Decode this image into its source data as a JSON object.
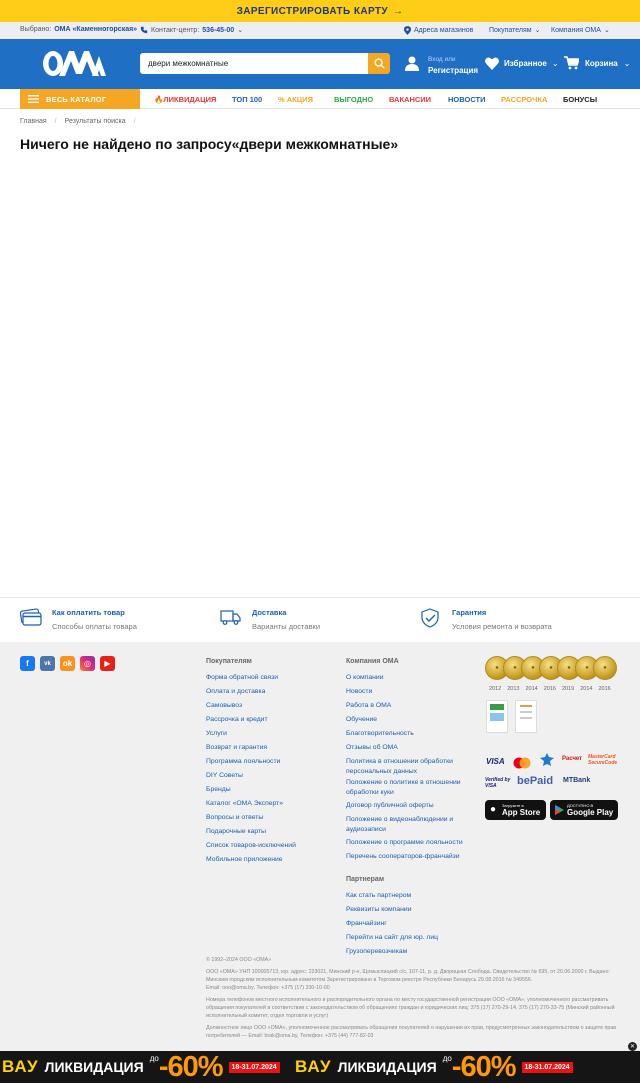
{
  "top_banner": {
    "label": "ЗАРЕГИСТРИРОВАТЬ КАРТУ",
    "arrow": "→"
  },
  "infobar": {
    "selected_prefix": "Выбрано:",
    "selected_store": "ОМА «Каменногорская»",
    "contact_label": "Контакт-центр:",
    "contact_number": "536-45-00",
    "stores_link": "Адреса магазинов",
    "buyers_menu": "Покупателям",
    "company_menu": "Компания ОМА"
  },
  "header": {
    "logo_text": "ОМА",
    "search_value": "двери межкомнатные",
    "login_hint": "Вход или",
    "register": "Регистрация",
    "favorites": "Избранное",
    "cart": "Корзина"
  },
  "nav": {
    "catalog": "ВЕСЬ КАТАЛОГ",
    "items": [
      {
        "label": "ЛИКВИДАЦИЯ",
        "color": "#e53935"
      },
      {
        "label": "ТОП 100",
        "color": "#1b5fb0"
      },
      {
        "label": "АКЦИЯ",
        "color": "#f5a623"
      },
      {
        "label": "ВЫГОДНО",
        "color": "#27a844"
      },
      {
        "label": "ВАКАНСИИ",
        "color": "#e53935"
      },
      {
        "label": "НОВОСТИ",
        "color": "#1b5fb0"
      },
      {
        "label": "РАССРОЧКА",
        "color": "#f5a623"
      },
      {
        "label": "БОНУСЫ",
        "color": "#222222"
      }
    ]
  },
  "breadcrumb": {
    "home": "Главная",
    "current": "Результаты поиска"
  },
  "page_title": "Ничего не найдено по запросу«двери межкомнатные»",
  "features": [
    {
      "title": "Как оплатить товар",
      "subtitle": "Способы оплаты товара"
    },
    {
      "title": "Доставка",
      "subtitle": "Варианты доставки"
    },
    {
      "title": "Гарантия",
      "subtitle": "Условия ремонта и возврата"
    }
  ],
  "footer": {
    "buyers_heading": "Покупателям",
    "buyers_links": [
      "Форма обратной связи",
      "Оплата и доставка",
      "Самовывоз",
      "Рассрочка и кредит",
      "Услуги",
      "Возврат и гарантия",
      "Программа лояльности",
      "DIY Советы",
      "Бренды",
      "Каталог «ОМА Эксперт»",
      "Вопросы и ответы",
      "Подарочные карты",
      "Список товаров-исключений",
      "Мобильное приложение"
    ],
    "company_heading": "Компания ОМА",
    "company_links": [
      "О компании",
      "Новости",
      "Работа в ОМА",
      "Обучение",
      "Благотворительность",
      "Отзывы об ОМА",
      "Политика в отношении обработки персональных данных",
      "Положение о политике в отношении обработки куки",
      "Договор публичной оферты",
      "Положение о видеонаблюдении и аудиозаписи",
      "Положение о программе лояльности",
      "Перечень сооператоров-франчайзи"
    ],
    "partners_heading": "Партнерам",
    "partners_links": [
      "Как стать партнером",
      "Реквизиты компании",
      "Франчайзинг",
      "Перейти на сайт для юр. лиц",
      "Грузоперевозчикам"
    ],
    "medal_years": [
      "2012",
      "2013",
      "2014",
      "2016",
      "2019",
      "2014",
      "2016"
    ],
    "payments": [
      "VISA",
      "MasterCard",
      "Белкарт",
      "Расчет",
      "MasterCard SecureCode",
      "Verified by VISA",
      "bePaid",
      "MTBank"
    ],
    "app_store": {
      "small": "Загрузите в",
      "big": "App Store"
    },
    "google_play": {
      "small": "ДОСТУПНО В",
      "big": "Google Play"
    },
    "copyright": "© 1992–2024 ООО «ОМА»",
    "legal_1": "ООО «ОМА» УНП 100005713, юр. адрес: 223021, Минский р-н, Щомыслицкий с/с, 107-11, р. д. Дворицкая Слобода. Свидетельство № 695, от 20.06.2000 г. Выдано: Минским городским исполнительным комитетом Зарегистрировано в Торговом реестре Республики Беларусь 29.08.2016 № 349556.",
    "legal_email": "Email: ooo@oma.by, Телефон: +375 (17) 330-10-00",
    "legal_2": "Номера телефонов местного исполнительного и распорядительного органа по месту государственной регистрации ООО «ОМА», уполномоченного рассматривать обращения покупателей в соответствии с законодательством об обращениях граждан и юридических лиц: 375 (17) 270-29-14, 375 (17) 270-33-75 (Минский районный исполнительный комитет, отдел торговли и услуг)",
    "legal_3": "Должностное лицо ООО «ОМА», уполномоченное рассматривать обращения покупателей о нарушении их прав, предусмотренных законодательством о защите прав потребителей — Email: brak@oma.by, Телефон: +375 (44) 777-82-03"
  },
  "promo": {
    "wow": "ВАУ",
    "label": "ЛИКВИДАЦИЯ",
    "upto": "до",
    "percent": "-60%",
    "dates": "18-31.07.2024"
  },
  "colors": {
    "brand_blue": "#1f6fc5",
    "accent_orange": "#f5a623",
    "banner_yellow": "#ffcc18"
  }
}
